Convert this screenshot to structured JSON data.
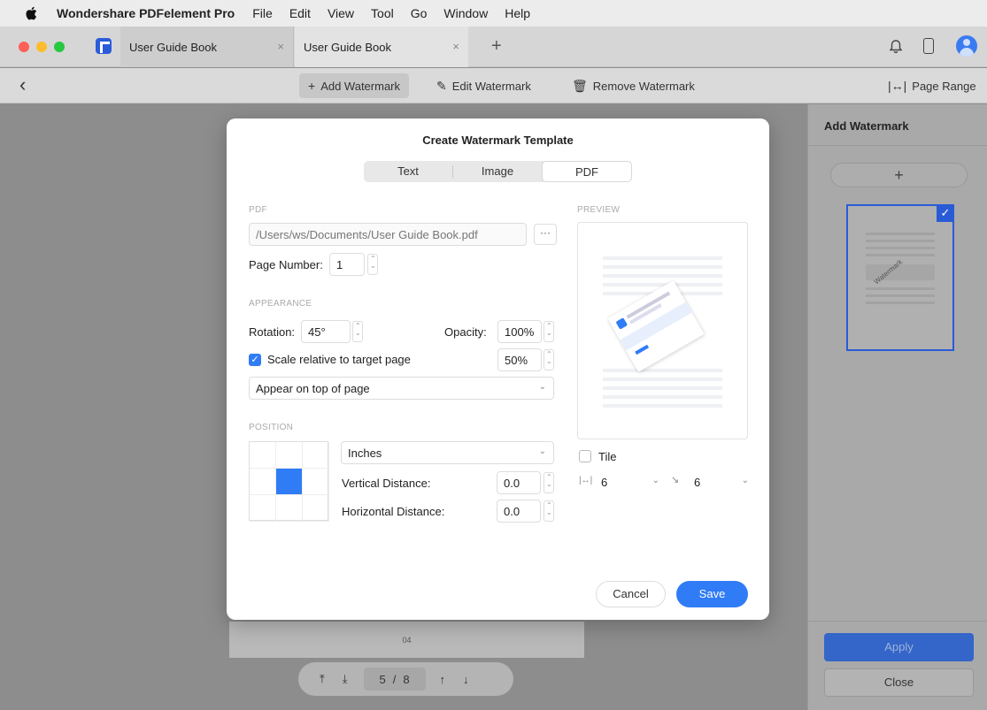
{
  "menubar": {
    "app_name": "Wondershare PDFelement Pro",
    "items": [
      "File",
      "Edit",
      "View",
      "Tool",
      "Go",
      "Window",
      "Help"
    ]
  },
  "tabs": [
    {
      "label": "User Guide Book",
      "close": "×"
    },
    {
      "label": "User Guide Book",
      "close": "×"
    }
  ],
  "new_tab": "+",
  "toolbar": {
    "back": "‹",
    "add_watermark": "Add Watermark",
    "edit_watermark": "Edit Watermark",
    "remove_watermark": "Remove Watermark",
    "page_range": "Page Range"
  },
  "document": {
    "page_label": "04",
    "pager": {
      "current": "5",
      "sep": "/",
      "total": "8"
    }
  },
  "right_panel": {
    "title": "Add Watermark",
    "add": "+",
    "thumb_text": "Watermark",
    "apply": "Apply",
    "close": "Close"
  },
  "dialog": {
    "title": "Create Watermark Template",
    "tabs": [
      "Text",
      "Image",
      "PDF"
    ],
    "active_tab": "PDF",
    "pdf_section": "PDF",
    "pdf_path": "/Users/ws/Documents/User Guide Book.pdf",
    "more": "···",
    "page_number_label": "Page Number:",
    "page_number": "1",
    "appearance_section": "APPEARANCE",
    "rotation_label": "Rotation:",
    "rotation": "45°",
    "opacity_label": "Opacity:",
    "opacity": "100%",
    "scale_checked": true,
    "scale_label": "Scale relative to target page",
    "scale": "50%",
    "layer": "Appear on top of page",
    "position_section": "POSITION",
    "units": "Inches",
    "vertical_label": "Vertical Distance:",
    "vertical": "0.0",
    "horizontal_label": "Horizontal Distance:",
    "horizontal": "0.0",
    "preview_section": "PREVIEW",
    "tile_label": "Tile",
    "tile_checked": false,
    "tile_h": "6",
    "tile_v": "6",
    "cancel": "Cancel",
    "save": "Save"
  },
  "colors": {
    "accent": "#2f7cf6",
    "dark_accent": "#2a5bd7"
  }
}
